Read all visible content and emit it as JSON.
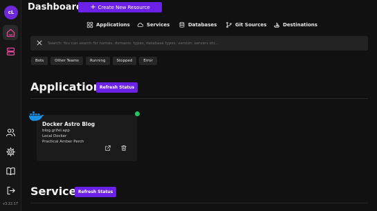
{
  "sidebar": {
    "avatar_initials": "cL",
    "version": "v3.22.17",
    "top_items": [
      {
        "name": "home",
        "icon": "home-icon",
        "active": true
      },
      {
        "name": "servers",
        "icon": "server-icon",
        "active": false
      }
    ],
    "bottom_items": [
      {
        "name": "team",
        "icon": "users-icon"
      },
      {
        "name": "settings",
        "icon": "gear-icon"
      },
      {
        "name": "docs",
        "icon": "book-icon"
      },
      {
        "name": "logout",
        "icon": "logout-icon"
      }
    ]
  },
  "header": {
    "title": "Dashboard",
    "create_label": "Create New Resource",
    "create_icon": "plus-icon"
  },
  "nav": [
    {
      "label": "Applications",
      "icon": "apps-grid-icon"
    },
    {
      "label": "Services",
      "icon": "cloud-icon"
    },
    {
      "label": "Databases",
      "icon": "database-icon"
    },
    {
      "label": "Git Sources",
      "icon": "git-branch-icon"
    },
    {
      "label": "Destinations",
      "icon": "destination-icon"
    }
  ],
  "search": {
    "placeholder": "Search: You can search for names, domains, types, database types, version, servers etc...",
    "value": ""
  },
  "filters": [
    "Bots",
    "Other Teams",
    "Running",
    "Stopped",
    "Error"
  ],
  "applications": {
    "title": "Applications",
    "refresh_label": "Refresh Status",
    "cards": [
      {
        "name": "Docker Astro Blog",
        "domain": "blog.grifel.app",
        "destination": "Local Docker",
        "server": "Practical Amber Perch",
        "status_color": "#22c55e",
        "type_icon": "docker-icon"
      }
    ]
  },
  "services": {
    "title": "Services",
    "refresh_label": "Refresh Status"
  },
  "colors": {
    "accent": "#6b21e8",
    "background": "#111111",
    "running": "#22c55e"
  }
}
